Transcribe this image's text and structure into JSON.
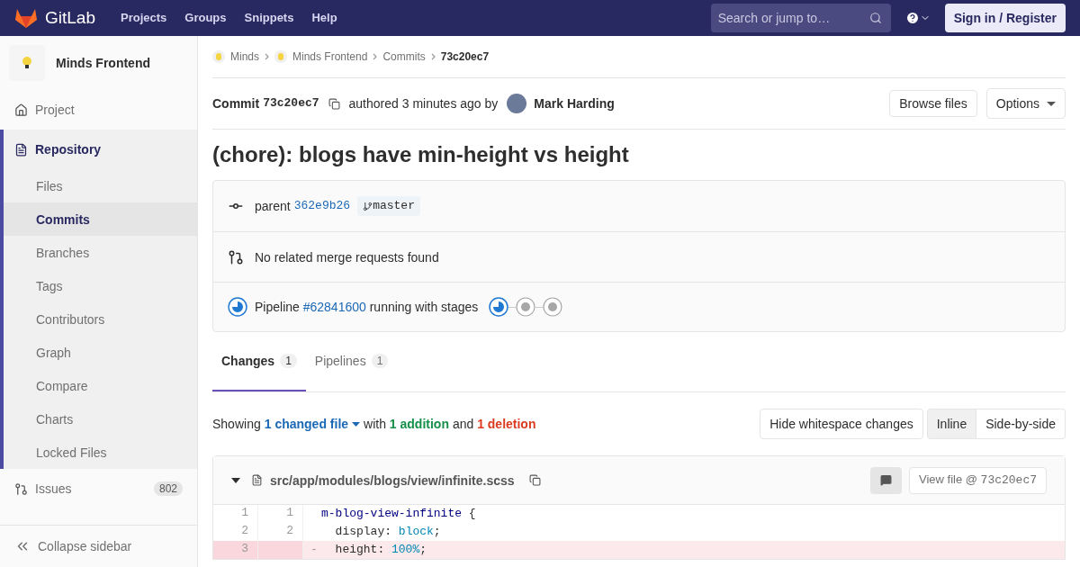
{
  "navbar": {
    "brand": "GitLab",
    "links": [
      "Projects",
      "Groups",
      "Snippets",
      "Help"
    ],
    "search": {
      "placeholder": "Search or jump to…"
    },
    "sign_in": "Sign in / Register"
  },
  "sidebar": {
    "project": "Minds Frontend",
    "items": [
      {
        "label": "Project",
        "selected": false
      },
      {
        "label": "Repository",
        "selected": true,
        "children": [
          {
            "label": "Files",
            "selected": false
          },
          {
            "label": "Commits",
            "selected": true
          },
          {
            "label": "Branches",
            "selected": false
          },
          {
            "label": "Tags",
            "selected": false
          },
          {
            "label": "Contributors",
            "selected": false
          },
          {
            "label": "Graph",
            "selected": false
          },
          {
            "label": "Compare",
            "selected": false
          },
          {
            "label": "Charts",
            "selected": false
          },
          {
            "label": "Locked Files",
            "selected": false
          }
        ]
      },
      {
        "label": "Issues",
        "selected": false,
        "count": "802"
      }
    ],
    "collapse": "Collapse sidebar"
  },
  "breadcrumbs": [
    {
      "label": "Minds",
      "avatar": true
    },
    {
      "label": "Minds Frontend",
      "avatar": true
    },
    {
      "label": "Commits",
      "avatar": false
    },
    {
      "label": "73c20ec7",
      "avatar": false
    }
  ],
  "commit": {
    "label": "Commit",
    "sha": "73c20ec7",
    "authored": "authored 3 minutes ago by",
    "author": "Mark Harding",
    "browse": "Browse files",
    "options": "Options",
    "title": "(chore): blogs have min-height vs height"
  },
  "info": {
    "parent_label": "parent",
    "parent_sha": "362e9b26",
    "branch": "master",
    "merge_requests": "No related merge requests found",
    "pipeline": {
      "kind": "running",
      "label": "Pipeline",
      "link": "#62841600",
      "text": "running with stages"
    },
    "stages": [
      {
        "kind": "running"
      },
      {
        "kind": "created"
      },
      {
        "kind": "created"
      }
    ]
  },
  "tabs": [
    {
      "label": "Changes",
      "count": "1",
      "selected": true
    },
    {
      "label": "Pipelines",
      "count": "1",
      "selected": false
    }
  ],
  "summary": {
    "showing": "Showing",
    "files": "1 changed file",
    "with": "with",
    "additions": "1 addition",
    "and": "and",
    "deletions": "1 deletion"
  },
  "view_controls": {
    "whitespace": "Hide whitespace changes",
    "modes": [
      {
        "label": "Inline",
        "selected": true
      },
      {
        "label": "Side-by-side",
        "selected": false
      }
    ]
  },
  "file": {
    "expanded": true,
    "path": "src/app/modules/blogs/view/infinite.scss",
    "view_file": "View file @",
    "view_sha": "73c20ec7",
    "lines": [
      {
        "kind": "context",
        "old": "1",
        "new": "1",
        "tokens": [
          {
            "text": "m-blog-view-infinite",
            "kind": "selector"
          },
          {
            "text": " {",
            "kind": "plain"
          }
        ]
      },
      {
        "kind": "context",
        "old": "2",
        "new": "2",
        "tokens": [
          {
            "text": "  display: ",
            "kind": "plain"
          },
          {
            "text": "block",
            "kind": "value"
          },
          {
            "text": ";",
            "kind": "plain"
          }
        ]
      },
      {
        "kind": "removed",
        "old": "3",
        "sign": "-",
        "tokens": [
          {
            "text": "  height: ",
            "kind": "plain"
          },
          {
            "text": "100%",
            "kind": "value"
          },
          {
            "text": ";",
            "kind": "plain"
          }
        ]
      }
    ]
  }
}
